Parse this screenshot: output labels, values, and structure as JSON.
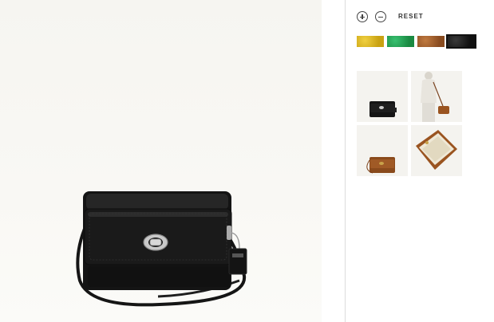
{
  "controls": {
    "zoom_in": "zoom-in",
    "zoom_out": "zoom-out",
    "reset_label": "RESET"
  },
  "swatches": [
    {
      "color": "#d6b31a",
      "name": "yellow",
      "selected": false
    },
    {
      "color": "#1f9a4e",
      "name": "green",
      "selected": false
    },
    {
      "color": "#9a5a2a",
      "name": "brown",
      "selected": false
    },
    {
      "color": "#1c1c1c",
      "name": "black",
      "selected": true
    }
  ],
  "thumbnails": [
    {
      "view": "black-front"
    },
    {
      "view": "brown-worn-model"
    },
    {
      "view": "brown-front"
    },
    {
      "view": "brown-open-interior"
    }
  ],
  "colors": {
    "background": "#f7f6f2",
    "bag_black": "#161616",
    "hardware": "#b8b8b8"
  }
}
